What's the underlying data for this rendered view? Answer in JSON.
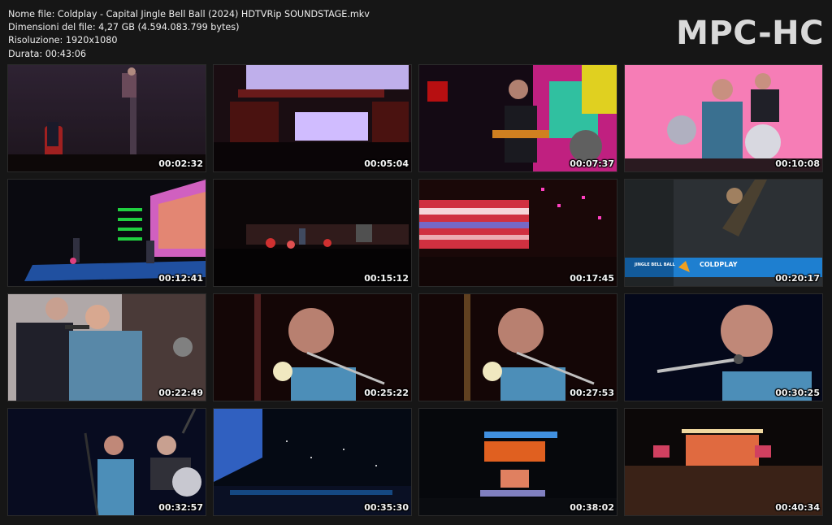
{
  "info": {
    "filename_line": "Nome file: Coldplay - Capital Jingle Bell Ball (2024) HDTVRip SOUNDSTAGE.mkv",
    "size_line": "Dimensioni del file: 4,27 GB (4.594.083.799 bytes)",
    "resolution_line": "Risoluzione: 1920x1080",
    "duration_line": "Durata: 00:43:06"
  },
  "logo": "MPC-HC",
  "thumbnails": [
    {
      "time": "00:02:32"
    },
    {
      "time": "00:05:04"
    },
    {
      "time": "00:07:37"
    },
    {
      "time": "00:10:08"
    },
    {
      "time": "00:12:41"
    },
    {
      "time": "00:15:12"
    },
    {
      "time": "00:17:45"
    },
    {
      "time": "00:20:17",
      "banner_title": "COLDPLAY",
      "banner_logo": "JINGLE BELL BALL"
    },
    {
      "time": "00:22:49"
    },
    {
      "time": "00:25:22"
    },
    {
      "time": "00:27:53"
    },
    {
      "time": "00:30:25"
    },
    {
      "time": "00:32:57"
    },
    {
      "time": "00:35:30"
    },
    {
      "time": "00:38:02"
    },
    {
      "time": "00:40:34"
    }
  ],
  "colors": {
    "background": "#161616",
    "banner_blue": "#1e7fd0"
  }
}
